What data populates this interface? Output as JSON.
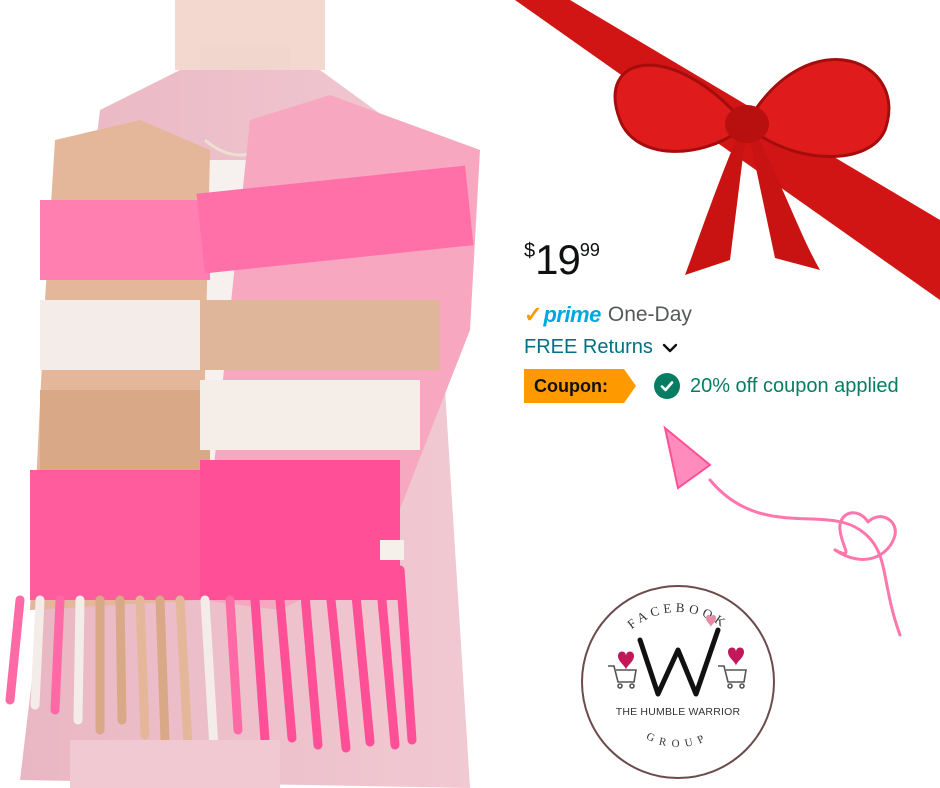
{
  "price": {
    "symbol": "$",
    "whole": "19",
    "fraction": "99"
  },
  "delivery": {
    "prime_label": "prime",
    "speed": "One-Day"
  },
  "returns": {
    "label": "FREE Returns"
  },
  "coupon": {
    "tag_label": "Coupon:",
    "applied_text": "20% off coupon applied"
  },
  "badge": {
    "top_text": "FACEBOOK",
    "name": "THE HUMBLE WARRIOR",
    "bottom_text": "GROUP",
    "monogram": "W"
  },
  "colors": {
    "prime_check": "#ff9900",
    "prime_blue": "#00a8e1",
    "link_teal": "#007185",
    "coupon_orange": "#ff9900",
    "success_green": "#067d62",
    "ribbon_red": "#d11414",
    "neon_pink": "#ff6fa8"
  }
}
